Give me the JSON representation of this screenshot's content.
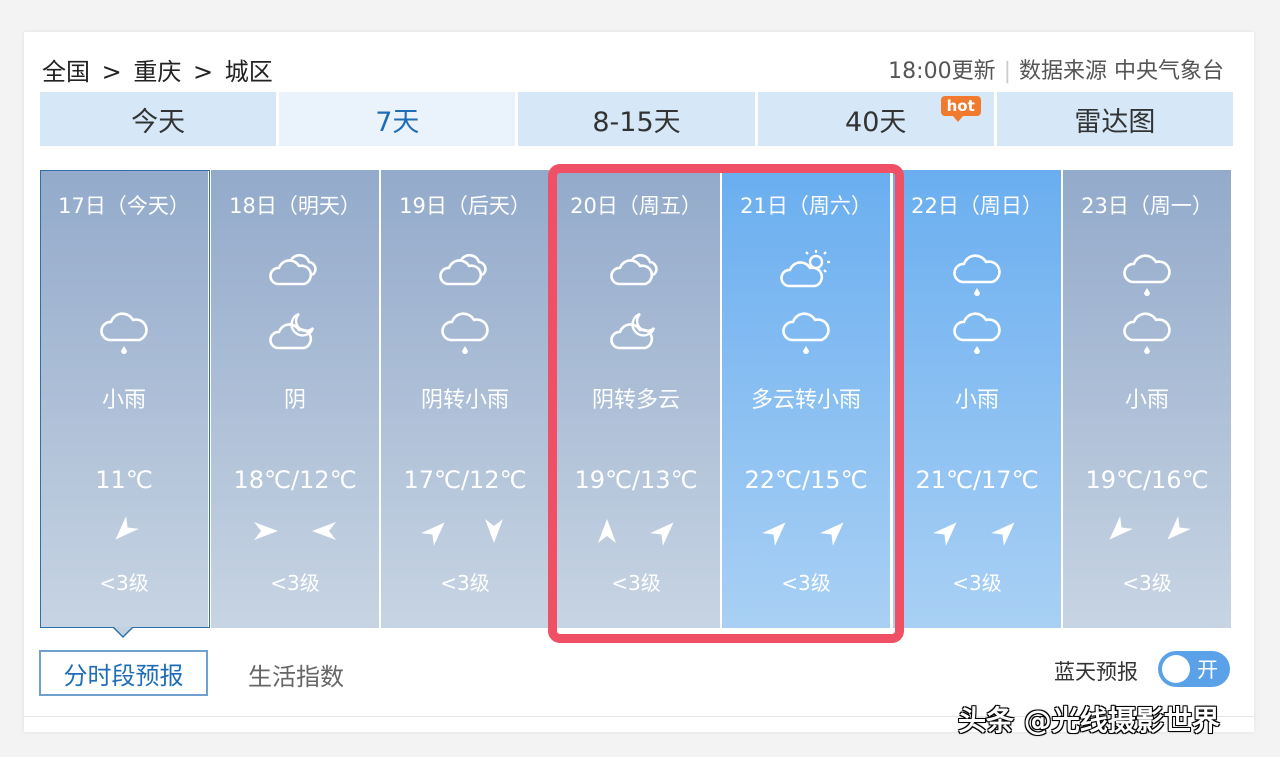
{
  "breadcrumb": {
    "items": [
      "全国",
      ">",
      "重庆",
      ">",
      "城区"
    ]
  },
  "header": {
    "update_time": "18:00更新",
    "source": "数据来源 中央气象台"
  },
  "tabs": [
    {
      "label": "今天"
    },
    {
      "label": "7天"
    },
    {
      "label": "8-15天"
    },
    {
      "label": "40天",
      "badge": "hot"
    },
    {
      "label": "雷达图"
    }
  ],
  "days": [
    {
      "date": "17日（今天）",
      "icon_day": "",
      "icon_night": "rain-icon",
      "desc": "小雨",
      "temp": "11℃",
      "winds": [
        "wind-arrow-sw"
      ],
      "level": "<3级"
    },
    {
      "date": "18日（明天）",
      "icon_day": "cloudy-icon",
      "icon_night": "partly-cloudy-night-icon",
      "desc": "阴",
      "temp": "18℃/12℃",
      "winds": [
        "wind-arrow-e",
        "wind-arrow-w"
      ],
      "level": "<3级"
    },
    {
      "date": "19日（后天）",
      "icon_day": "cloudy-icon",
      "icon_night": "rain-icon",
      "desc": "阴转小雨",
      "temp": "17℃/12℃",
      "winds": [
        "wind-arrow-ne",
        "wind-arrow-s"
      ],
      "level": "<3级"
    },
    {
      "date": "20日（周五）",
      "icon_day": "cloudy-icon",
      "icon_night": "partly-cloudy-night-icon",
      "desc": "阴转多云",
      "temp": "19℃/13℃",
      "winds": [
        "wind-arrow-n",
        "wind-arrow-ne"
      ],
      "level": "<3级"
    },
    {
      "date": "21日（周六）",
      "icon_day": "partly-cloudy-day-icon",
      "icon_night": "rain-icon",
      "desc": "多云转小雨",
      "temp": "22℃/15℃",
      "winds": [
        "wind-arrow-ne",
        "wind-arrow-ne"
      ],
      "level": "<3级"
    },
    {
      "date": "22日（周日）",
      "icon_day": "rain-icon",
      "icon_night": "rain-icon",
      "desc": "小雨",
      "temp": "21℃/17℃",
      "winds": [
        "wind-arrow-ne",
        "wind-arrow-ne"
      ],
      "level": "<3级"
    },
    {
      "date": "23日（周一）",
      "icon_day": "rain-icon",
      "icon_night": "rain-icon",
      "desc": "小雨",
      "temp": "19℃/16℃",
      "winds": [
        "wind-arrow-sw",
        "wind-arrow-sw"
      ],
      "level": "<3级"
    }
  ],
  "subtabs": {
    "active": "分时段预报",
    "other": "生活指数"
  },
  "blue_sky": {
    "label": "蓝天预报",
    "toggle": "开"
  },
  "watermark": "头条 @光线摄影世界",
  "colors": {
    "highlight": "#f05065",
    "accent": "#1f6db7",
    "tab_bg": "#d6e8f8",
    "hot_badge": "#f07a2d"
  }
}
